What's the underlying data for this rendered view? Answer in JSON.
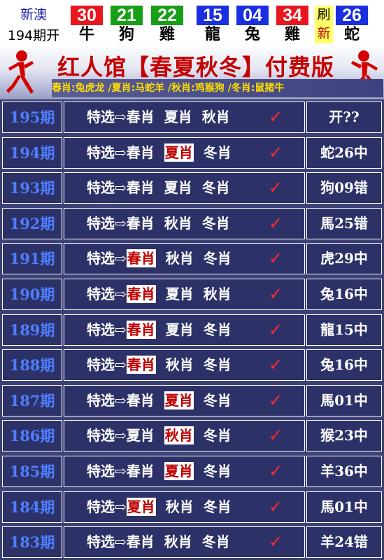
{
  "header": {
    "brand_line1": "新澳",
    "brand_line2": "194期开",
    "balls": [
      {
        "num": "30",
        "zodiac": "牛",
        "color": "#e8161e"
      },
      {
        "num": "21",
        "zodiac": "狗",
        "color": "#17a017"
      },
      {
        "num": "22",
        "zodiac": "雞",
        "color": "#17a017"
      },
      {
        "num": "15",
        "zodiac": "龍",
        "color": "#1a2fe0"
      },
      {
        "num": "04",
        "zodiac": "兔",
        "color": "#1a2fe0"
      },
      {
        "num": "34",
        "zodiac": "雞",
        "color": "#e8161e"
      }
    ],
    "flash_top": "刷",
    "flash_bottom": "新",
    "special": {
      "num": "26",
      "zodiac": "蛇",
      "color": "#1a2fe0"
    }
  },
  "banner": {
    "title": "红人馆【春夏秋冬】付费版",
    "subtitle": "春肖:兔虎龙 /夏肖:马蛇羊 /秋肖:鸡猴狗 /冬肖:鼠猪牛"
  },
  "table": {
    "pick_label": "特选⇨",
    "check_mark": "✓",
    "rows": [
      {
        "period": "195期",
        "picks": [
          {
            "text": "春肖",
            "hit": false
          },
          {
            "text": "夏肖",
            "hit": false
          },
          {
            "text": "秋肖",
            "hit": false
          }
        ],
        "result": "开??"
      },
      {
        "period": "194期",
        "picks": [
          {
            "text": "春肖",
            "hit": false
          },
          {
            "text": "夏肖",
            "hit": true
          },
          {
            "text": "冬肖",
            "hit": false
          }
        ],
        "result": "蛇26中"
      },
      {
        "period": "193期",
        "picks": [
          {
            "text": "春肖",
            "hit": false
          },
          {
            "text": "夏肖",
            "hit": false
          },
          {
            "text": "冬肖",
            "hit": false
          }
        ],
        "result": "狗09错"
      },
      {
        "period": "192期",
        "picks": [
          {
            "text": "春肖",
            "hit": false
          },
          {
            "text": "秋肖",
            "hit": false
          },
          {
            "text": "冬肖",
            "hit": false
          }
        ],
        "result": "馬25错"
      },
      {
        "period": "191期",
        "picks": [
          {
            "text": "春肖",
            "hit": true
          },
          {
            "text": "秋肖",
            "hit": false
          },
          {
            "text": "冬肖",
            "hit": false
          }
        ],
        "result": "虎29中"
      },
      {
        "period": "190期",
        "picks": [
          {
            "text": "春肖",
            "hit": true
          },
          {
            "text": "夏肖",
            "hit": false
          },
          {
            "text": "秋肖",
            "hit": false
          }
        ],
        "result": "兔16中"
      },
      {
        "period": "189期",
        "picks": [
          {
            "text": "春肖",
            "hit": true
          },
          {
            "text": "夏肖",
            "hit": false
          },
          {
            "text": "冬肖",
            "hit": false
          }
        ],
        "result": "龍15中"
      },
      {
        "period": "188期",
        "picks": [
          {
            "text": "春肖",
            "hit": true
          },
          {
            "text": "秋肖",
            "hit": false
          },
          {
            "text": "冬肖",
            "hit": false
          }
        ],
        "result": "兔16中"
      },
      {
        "period": "187期",
        "picks": [
          {
            "text": "春肖",
            "hit": false
          },
          {
            "text": "夏肖",
            "hit": true
          },
          {
            "text": "冬肖",
            "hit": false
          }
        ],
        "result": "馬01中"
      },
      {
        "period": "186期",
        "picks": [
          {
            "text": "夏肖",
            "hit": false
          },
          {
            "text": "秋肖",
            "hit": true
          },
          {
            "text": "冬肖",
            "hit": false
          }
        ],
        "result": "猴23中"
      },
      {
        "period": "185期",
        "picks": [
          {
            "text": "春肖",
            "hit": false
          },
          {
            "text": "夏肖",
            "hit": true
          },
          {
            "text": "冬肖",
            "hit": false
          }
        ],
        "result": "羊36中"
      },
      {
        "period": "184期",
        "picks": [
          {
            "text": "夏肖",
            "hit": true
          },
          {
            "text": "秋肖",
            "hit": false
          },
          {
            "text": "冬肖",
            "hit": false
          }
        ],
        "result": "馬01中"
      },
      {
        "period": "183期",
        "picks": [
          {
            "text": "春肖",
            "hit": false
          },
          {
            "text": "秋肖",
            "hit": false
          },
          {
            "text": "冬肖",
            "hit": false
          }
        ],
        "result": "羊24错"
      }
    ]
  }
}
